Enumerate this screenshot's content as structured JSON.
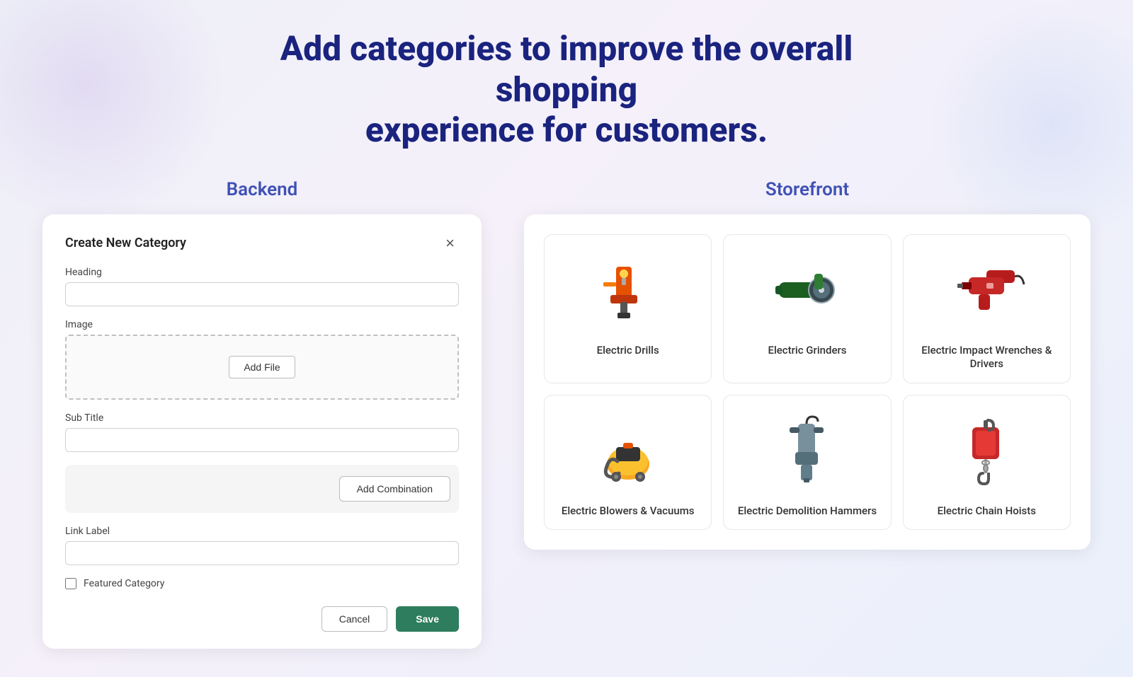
{
  "page": {
    "heading_line1": "Add categories to improve the overall shopping",
    "heading_line2": "experience for customers."
  },
  "backend": {
    "label": "Backend",
    "card_title": "Create New Category",
    "close_icon": "×",
    "heading_label": "Heading",
    "heading_placeholder": "",
    "image_label": "Image",
    "add_file_label": "Add File",
    "subtitle_label": "Sub Title",
    "subtitle_placeholder": "",
    "add_combination_label": "Add Combination",
    "link_label_label": "Link Label",
    "link_label_placeholder": "",
    "featured_label": "Featured Category",
    "cancel_label": "Cancel",
    "save_label": "Save"
  },
  "storefront": {
    "label": "Storefront",
    "categories": [
      {
        "id": "electric-drills",
        "name": "Electric Drills",
        "icon": "drill"
      },
      {
        "id": "electric-grinders",
        "name": "Electric Grinders",
        "icon": "grinder"
      },
      {
        "id": "electric-impact-wrenches",
        "name": "Electric Impact Wrenches & Drivers",
        "icon": "impact-wrench"
      },
      {
        "id": "electric-blowers",
        "name": "Electric Blowers & Vacuums",
        "icon": "vacuum"
      },
      {
        "id": "electric-demolition",
        "name": "Electric Demolition Hammers",
        "icon": "demolition-hammer"
      },
      {
        "id": "electric-chain-hoists",
        "name": "Electric Chain Hoists",
        "icon": "chain-hoist"
      }
    ]
  },
  "colors": {
    "heading_color": "#1a237e",
    "section_label_color": "#3f51b5",
    "save_bg": "#2e7d5e"
  }
}
